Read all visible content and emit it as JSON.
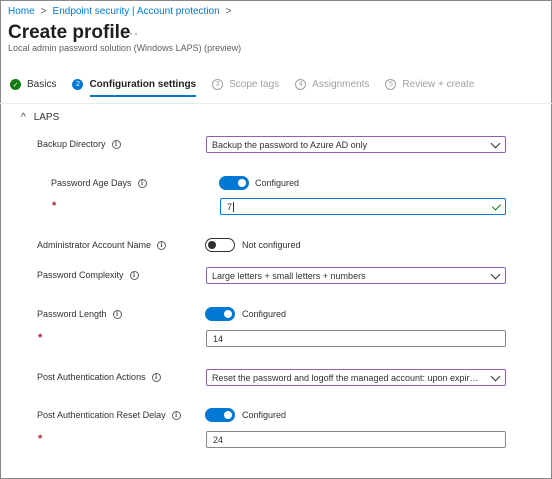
{
  "breadcrumb": {
    "home": "Home",
    "parent": "Endpoint security | Account protection",
    "separator": ">"
  },
  "header": {
    "title": "Create profile",
    "more": "···",
    "subtitle": "Local admin password solution (Windows LAPS) (preview)"
  },
  "steps": [
    {
      "number": "✓",
      "label": "Basics",
      "state": "done"
    },
    {
      "number": "2",
      "label": "Configuration settings",
      "state": "active"
    },
    {
      "number": "3",
      "label": "Scope tags",
      "state": "todo"
    },
    {
      "number": "4",
      "label": "Assignments",
      "state": "todo"
    },
    {
      "number": "5",
      "label": "Review + create",
      "state": "todo"
    }
  ],
  "section": {
    "title": "LAPS",
    "chevron": "^"
  },
  "info_glyph": "i",
  "required_marker": "*",
  "fields": {
    "backup_directory": {
      "label": "Backup Directory",
      "value": "Backup the password to Azure AD only"
    },
    "password_age_days": {
      "label": "Password Age Days",
      "toggle_label": "Configured",
      "toggle_on": true,
      "value": "7"
    },
    "administrator_account_name": {
      "label": "Administrator Account Name",
      "toggle_label": "Not configured",
      "toggle_on": false
    },
    "password_complexity": {
      "label": "Password Complexity",
      "value": "Large letters + small letters + numbers"
    },
    "password_length": {
      "label": "Password Length",
      "toggle_label": "Configured",
      "toggle_on": true,
      "value": "14"
    },
    "post_authentication_actions": {
      "label": "Post Authentication Actions",
      "value": "Reset the password and logoff the managed account: upon expiry of the grace period"
    },
    "post_authentication_reset_delay": {
      "label": "Post Authentication Reset Delay",
      "toggle_label": "Configured",
      "toggle_on": true,
      "value": "24"
    }
  },
  "colors": {
    "accent": "#0078d4",
    "success": "#107c10",
    "required": "#a4262c",
    "select_border": "#8764b8"
  }
}
